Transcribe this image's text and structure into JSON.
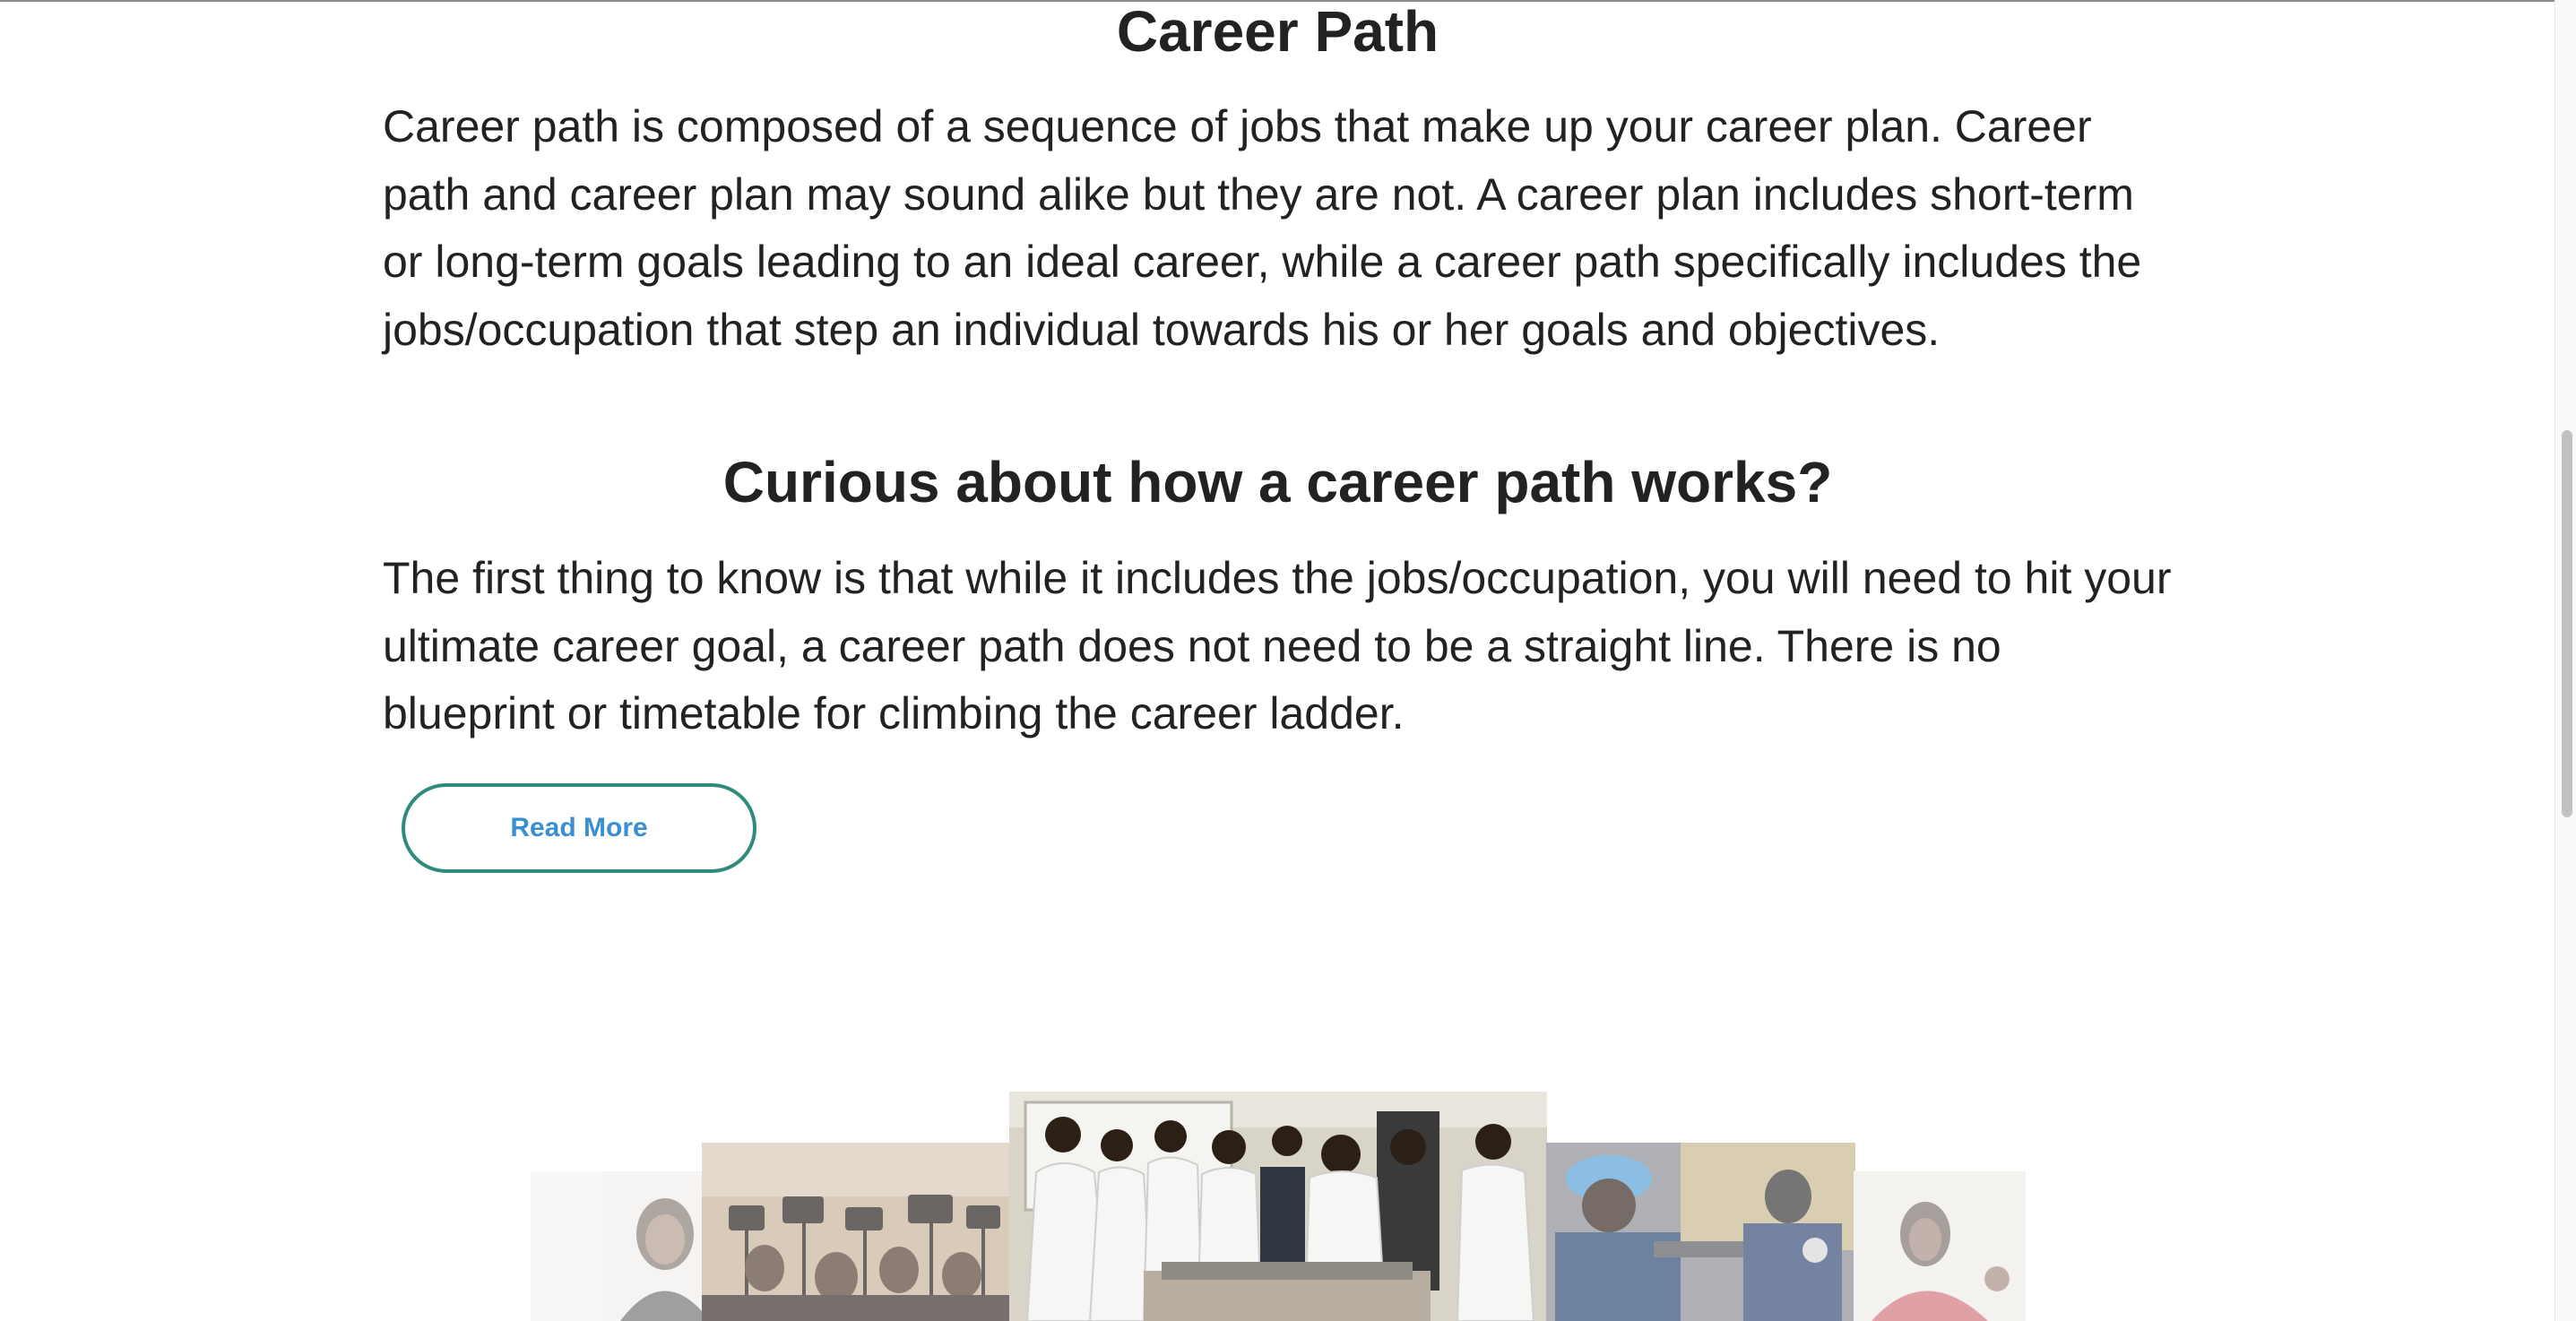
{
  "sections": [
    {
      "heading": "Career Path",
      "paragraph": "Career path is composed of a sequence of jobs that make up your career plan. Career path and career plan may sound alike but they are not. A career plan includes short-term or long-term goals leading to an ideal career, while a career path specifically includes the jobs/occupation that step an individual towards his or her goals and objectives."
    },
    {
      "heading": "Curious about how a career path works?",
      "paragraph": "The first thing to know is that while it includes the jobs/occupation, you will need to hit your ultimate career goal, a career path does not need to be a straight line. There is no blueprint or timetable for climbing the career ladder."
    }
  ],
  "read_more": {
    "label": "Read More"
  },
  "carousel": {
    "slides": [
      {
        "subject": "woman-portrait",
        "state": "far-left"
      },
      {
        "subject": "press-cameras",
        "state": "left"
      },
      {
        "subject": "lab-coats-group",
        "state": "active"
      },
      {
        "subject": "welding-worker",
        "state": "right"
      },
      {
        "subject": "woman-in-red",
        "state": "far-right"
      }
    ]
  },
  "colors": {
    "text": "#222222",
    "button_border": "#2e8b7d",
    "button_text": "#3a8fd0",
    "background": "#ffffff"
  }
}
